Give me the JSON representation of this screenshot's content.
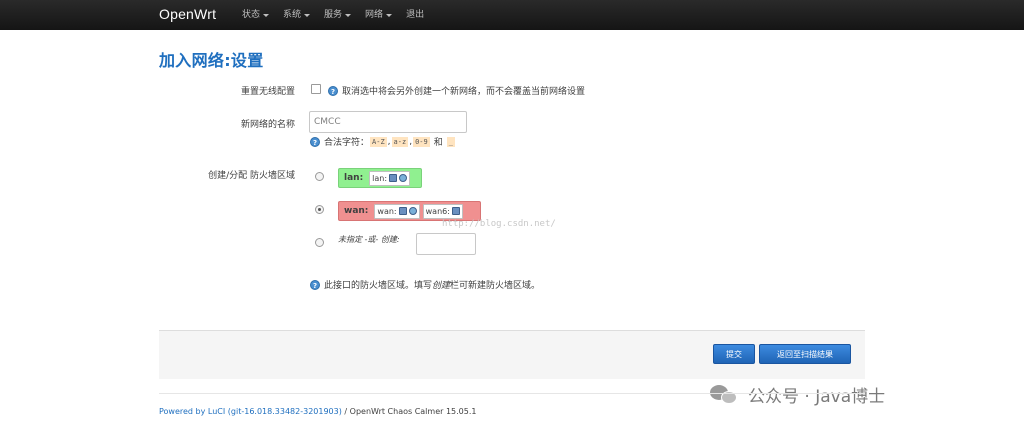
{
  "navbar": {
    "brand": "OpenWrt",
    "menu": [
      {
        "label": "状态"
      },
      {
        "label": "系统"
      },
      {
        "label": "服务"
      },
      {
        "label": "网络"
      },
      {
        "label": "退出"
      }
    ]
  },
  "page": {
    "title": "加入网络:设置"
  },
  "form": {
    "replace_label": "重置无线配置",
    "replace_help": "取消选中将会另外创建一个新网络，而不会覆盖当前网络设置",
    "name_label": "新网络的名称",
    "name_value": "CMCC",
    "name_help_prefix": "合法字符：",
    "name_chars": [
      "A-Z",
      "a-z",
      "0-9"
    ],
    "name_and": "和",
    "name_underscore": "_",
    "zone_label": "创建/分配 防火墙区域",
    "zones": [
      {
        "name": "lan:",
        "color": "#90f090",
        "ifaces": [
          {
            "label": "lan:"
          }
        ]
      },
      {
        "name": "wan:",
        "color": "#f09090",
        "ifaces": [
          {
            "label": "wan:"
          },
          {
            "label": "wan6:"
          }
        ]
      }
    ],
    "unspecified_label": "未指定 -或- 创建:",
    "zone_help_a": "此接口的防火墙区域。填写",
    "zone_help_em": "创建",
    "zone_help_b": "栏可新建防火墙区域。",
    "selected_zone": "wan"
  },
  "watermark_url": "http://blog.csdn.net/",
  "actions": {
    "submit": "提交",
    "back": "返回至扫描结果"
  },
  "footer": {
    "link": "Powered by LuCI (git-16.018.33482-3201903)",
    "rest": "/ OpenWrt Chaos Calmer 15.05.1"
  },
  "wechat_watermark": "公众号 · Java博士"
}
